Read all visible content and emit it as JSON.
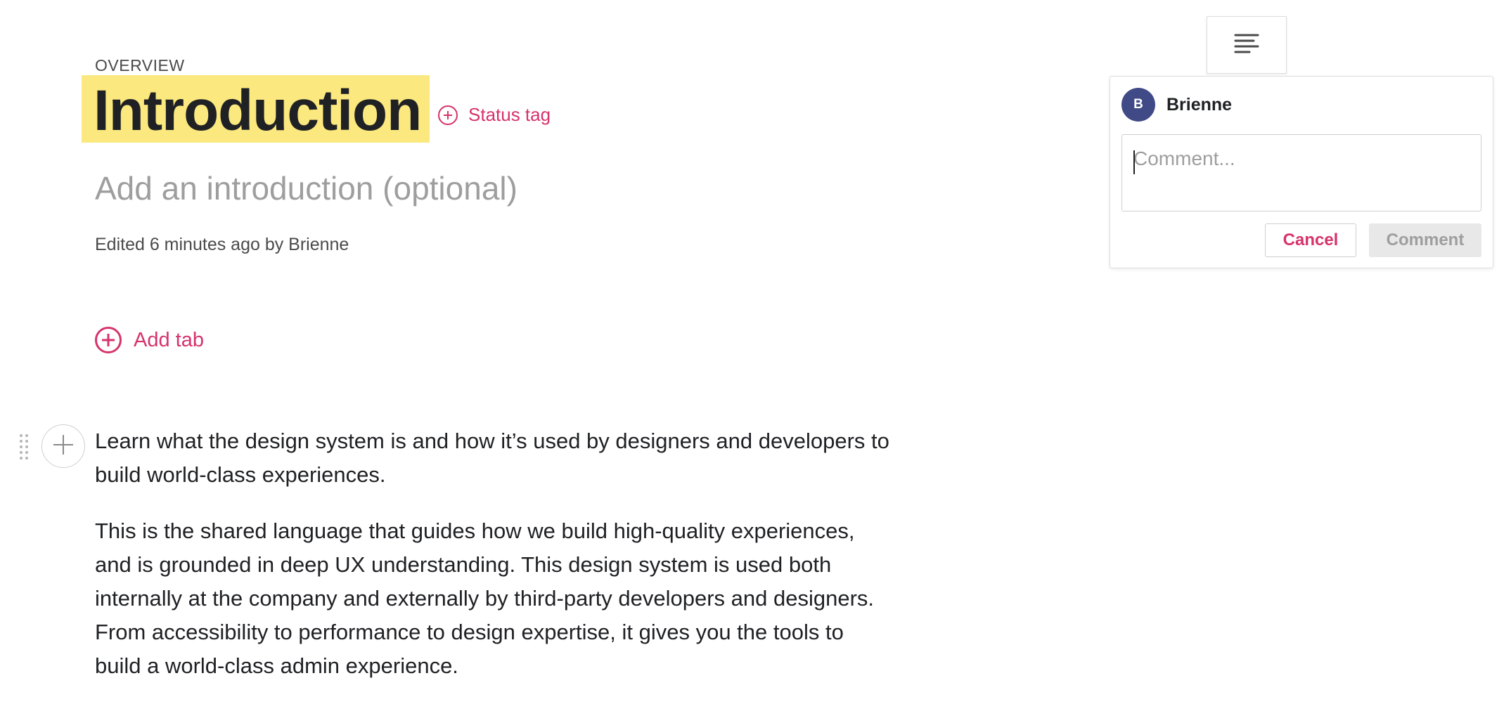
{
  "header": {
    "eyebrow": "OVERVIEW",
    "title": "Introduction",
    "status_tag_label": "Status tag",
    "intro_placeholder": "Add an introduction (optional)",
    "edited_meta": "Edited 6 minutes ago by Brienne",
    "title_highlight_color": "#fbe87e"
  },
  "tabs": {
    "add_tab_label": "Add tab"
  },
  "content": {
    "paragraphs": [
      "Learn what the design system is and how it’s used by designers and developers to build world-class  experiences.",
      "This is the shared language that guides how we build high-quality experiences, and is grounded in deep UX understanding. This design system is used both internally at the company and externally by third-party developers and designers. From accessibility to performance to design expertise, it gives you the tools to build a world-class admin experience."
    ]
  },
  "comment_panel": {
    "avatar_initial": "B",
    "avatar_color": "#404a86",
    "user_name": "Brienne",
    "input_value": "",
    "input_placeholder": "Comment...",
    "cancel_label": "Cancel",
    "submit_label": "Comment"
  },
  "icons": {
    "status_tag": "plus-circle-icon",
    "add_tab": "plus-circle-icon",
    "add_block": "plus-icon",
    "drag_handle": "drag-dots-icon",
    "align": "align-left-icon"
  },
  "colors": {
    "accent": "#d6336c",
    "text": "#202124",
    "muted": "#9e9e9e"
  }
}
